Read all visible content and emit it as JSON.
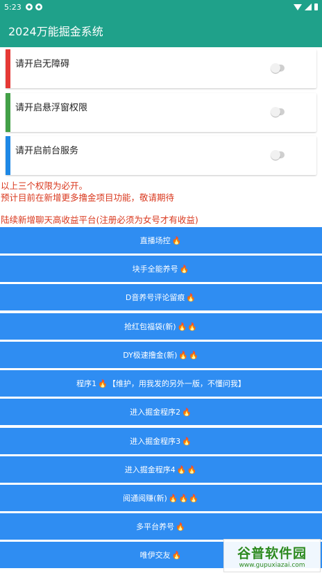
{
  "status_bar": {
    "time": "5:23"
  },
  "app": {
    "title": "2024万能掘金系统"
  },
  "permissions": [
    {
      "label": "请开启无障碍",
      "color": "#e53935",
      "enabled": false
    },
    {
      "label": "请开启悬浮窗权限",
      "color": "#43a047",
      "enabled": false
    },
    {
      "label": "请开启前台服务",
      "color": "#1e88e5",
      "enabled": false
    }
  ],
  "notices": {
    "line1": "以上三个权限为必开。",
    "line2": "预计目前在新增更多撸金项目功能，敬请期待",
    "line3": "陆续新增聊天高收益平台(注册必须为女号才有收益)"
  },
  "menu": [
    {
      "label": "直播场控",
      "fires": "🔥"
    },
    {
      "label": "块手全能养号",
      "fires": "🔥"
    },
    {
      "label": "D音养号评论留痕",
      "fires": "🔥"
    },
    {
      "label": "抢红包福袋(新)",
      "fires": "🔥🔥"
    },
    {
      "label": "DY极速撸金(新)",
      "fires": "🔥🔥"
    },
    {
      "label": "程序1",
      "fires": "🔥",
      "suffix": "【维护，用我发的另外一版，不懂问我】"
    },
    {
      "label": "进入掘金程序2",
      "fires": "🔥"
    },
    {
      "label": "进入掘金程序3",
      "fires": "🔥"
    },
    {
      "label": "进入掘金程序4",
      "fires": "🔥🔥"
    },
    {
      "label": "阅通阅赚(新)",
      "fires": "🔥🔥🔥"
    },
    {
      "label": "多平台养号",
      "fires": "🔥"
    },
    {
      "label": "唯伊交友",
      "fires": "🔥"
    }
  ],
  "watermark": {
    "brand": "谷普软件园",
    "url": "www.gupuxiazai.com"
  },
  "colors": {
    "primary": "#1fa18a",
    "button": "#2f8df2",
    "notice": "#d9381e"
  }
}
